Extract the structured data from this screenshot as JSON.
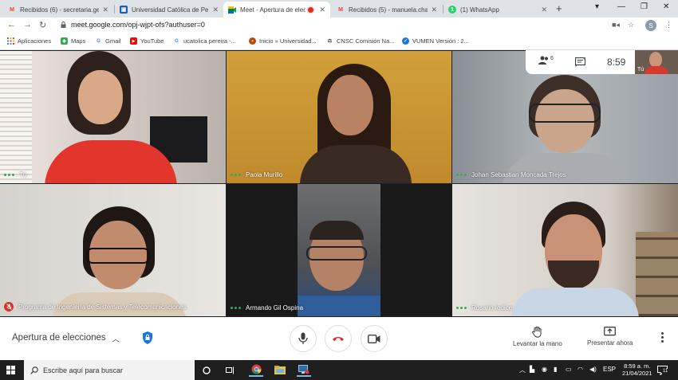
{
  "browser": {
    "tabs": [
      {
        "title": "Recibidos (6) - secretaria.gen",
        "favicon": "gmail-icon",
        "active": false
      },
      {
        "title": "Universidad Católica de Perei",
        "favicon": "university-icon",
        "active": false
      },
      {
        "title": "Meet - Apertura de elecc",
        "favicon": "meet-icon",
        "active": true
      },
      {
        "title": "Recibidos (5) - manuela.chali",
        "favicon": "gmail-icon",
        "active": false
      },
      {
        "title": "(1) WhatsApp",
        "favicon": "whatsapp-icon",
        "active": false
      }
    ],
    "url": "meet.google.com/opj-wjpt-ofs?authuser=0",
    "profile_initial": "S",
    "bookmarks": [
      {
        "label": "Aplicaciones",
        "icon": "apps-grid-icon"
      },
      {
        "label": "Maps",
        "icon": "maps-icon"
      },
      {
        "label": "Gmail",
        "icon": "google-icon"
      },
      {
        "label": "YouTube",
        "icon": "youtube-icon"
      },
      {
        "label": "ucatolica pereira -...",
        "icon": "google-icon"
      },
      {
        "label": "Inicio » Universidad...",
        "icon": "university-icon"
      },
      {
        "label": "CNSC Comisión Na...",
        "icon": "cnsc-icon"
      },
      {
        "label": "VUMEN Versión : 2...",
        "icon": "vumen-icon"
      }
    ]
  },
  "meet": {
    "time": "8:59",
    "participant_count_badge": "6",
    "self_thumb_label": "Tú",
    "participants": [
      {
        "name": "Tú",
        "mic_muted": false
      },
      {
        "name": "Paola Murillo",
        "mic_muted": false
      },
      {
        "name": "Johan Sebastian Moncada Trejos",
        "mic_muted": false
      },
      {
        "name": "Programa de Ingeniería de Sistemas y Telecomunicaciones",
        "mic_muted": true
      },
      {
        "name": "Armando Gil Ospina",
        "mic_muted": false
      },
      {
        "name": "Rosario Iodice",
        "mic_muted": false
      }
    ],
    "meeting_title": "Apertura de elecciones",
    "raise_hand_label": "Levantar la mano",
    "present_label": "Presentar ahora"
  },
  "taskbar": {
    "search_placeholder": "Escribe aquí para buscar",
    "language": "ESP",
    "time": "8:59 a. m.",
    "date": "21/04/2021",
    "notification_count": "11"
  },
  "colors": {
    "accent_green": "#34a853",
    "danger_red": "#d93025",
    "meet_blue": "#1a73e8"
  }
}
